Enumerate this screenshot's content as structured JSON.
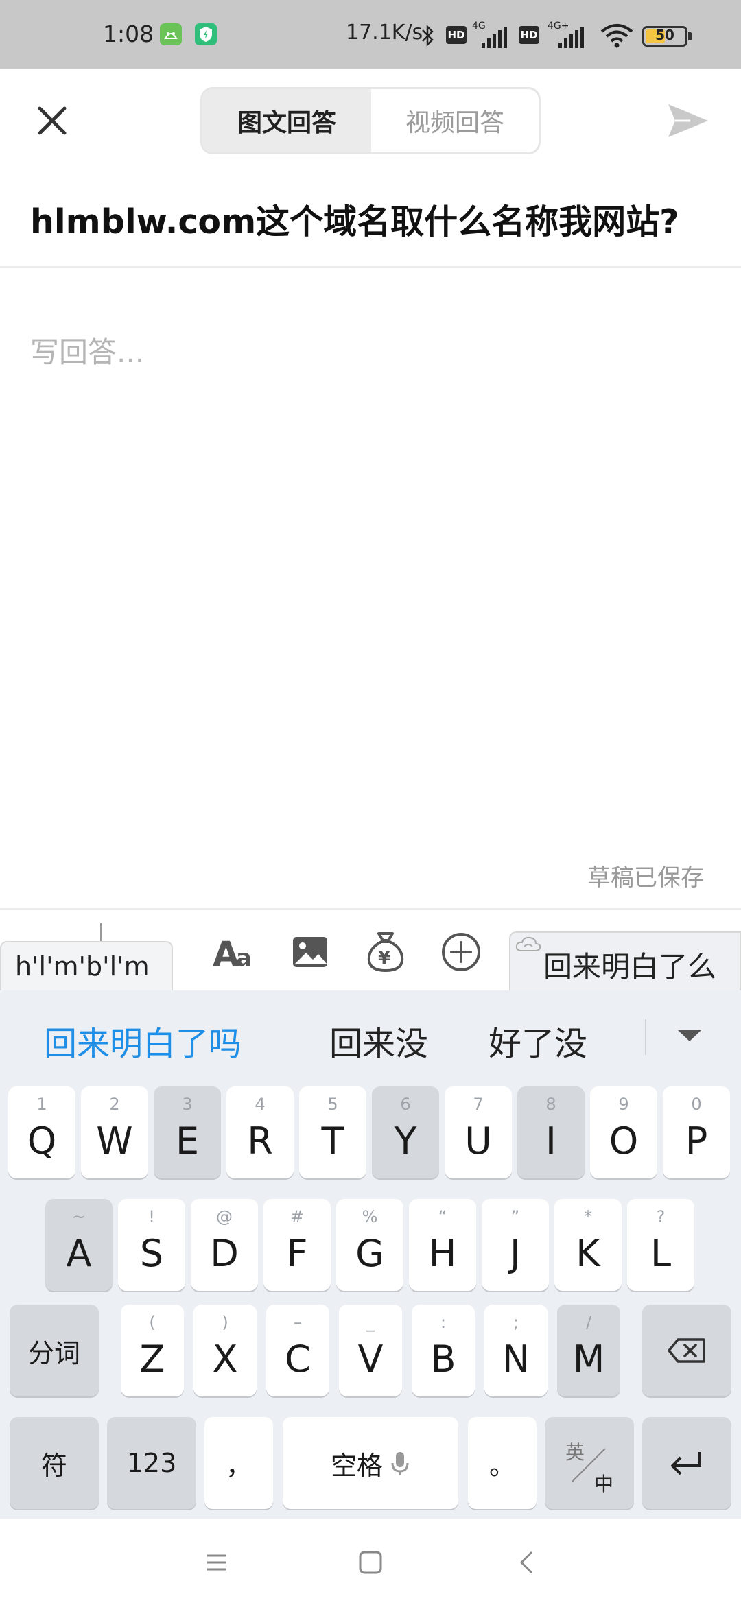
{
  "status_bar": {
    "time": "1:08",
    "net_speed": "17.1K/s",
    "hd1": "HD",
    "hd2": "HD",
    "net1": "4G",
    "net2": "4G+",
    "battery": "50",
    "battery_level": 0.5
  },
  "header": {
    "tab_active": "图文回答",
    "tab_inactive": "视频回答"
  },
  "question": {
    "title": "hlmblw.com这个域名取什么名称我网站?"
  },
  "editor": {
    "placeholder": "写回答...",
    "draft_status": "草稿已保存"
  },
  "ime": {
    "pinyin": "h'l'm'b'l'm",
    "cloud_candidate": "回来明白了么",
    "toolbar_icons": [
      "font-style-icon",
      "image-icon",
      "money-bag-icon",
      "add-circle-icon"
    ],
    "candidates": [
      "回来明白了吗",
      "回来没",
      "好了没"
    ],
    "rows": [
      {
        "keys": [
          {
            "h": "1",
            "k": "Q"
          },
          {
            "h": "2",
            "k": "W"
          },
          {
            "h": "3",
            "k": "E"
          },
          {
            "h": "4",
            "k": "R"
          },
          {
            "h": "5",
            "k": "T"
          },
          {
            "h": "6",
            "k": "Y"
          },
          {
            "h": "7",
            "k": "U"
          },
          {
            "h": "8",
            "k": "I"
          },
          {
            "h": "9",
            "k": "O"
          },
          {
            "h": "0",
            "k": "P"
          }
        ]
      },
      {
        "keys": [
          {
            "h": "~",
            "k": "A"
          },
          {
            "h": "!",
            "k": "S"
          },
          {
            "h": "@",
            "k": "D"
          },
          {
            "h": "#",
            "k": "F"
          },
          {
            "h": "%",
            "k": "G"
          },
          {
            "h": "“",
            "k": "H"
          },
          {
            "h": "”",
            "k": "J"
          },
          {
            "h": "*",
            "k": "K"
          },
          {
            "h": "?",
            "k": "L"
          }
        ]
      },
      {
        "keys": [
          {
            "h": "(",
            "k": "Z"
          },
          {
            "h": ")",
            "k": "X"
          },
          {
            "h": "–",
            "k": "C"
          },
          {
            "h": "_",
            "k": "V"
          },
          {
            "h": ":",
            "k": "B"
          },
          {
            "h": ";",
            "k": "N"
          },
          {
            "h": "/",
            "k": "M"
          }
        ]
      }
    ],
    "fenci": "分词",
    "fu": "符",
    "num": "123",
    "comma": "，",
    "space": "空格",
    "period": "。",
    "lang_top": "英",
    "lang_bottom": "中"
  }
}
